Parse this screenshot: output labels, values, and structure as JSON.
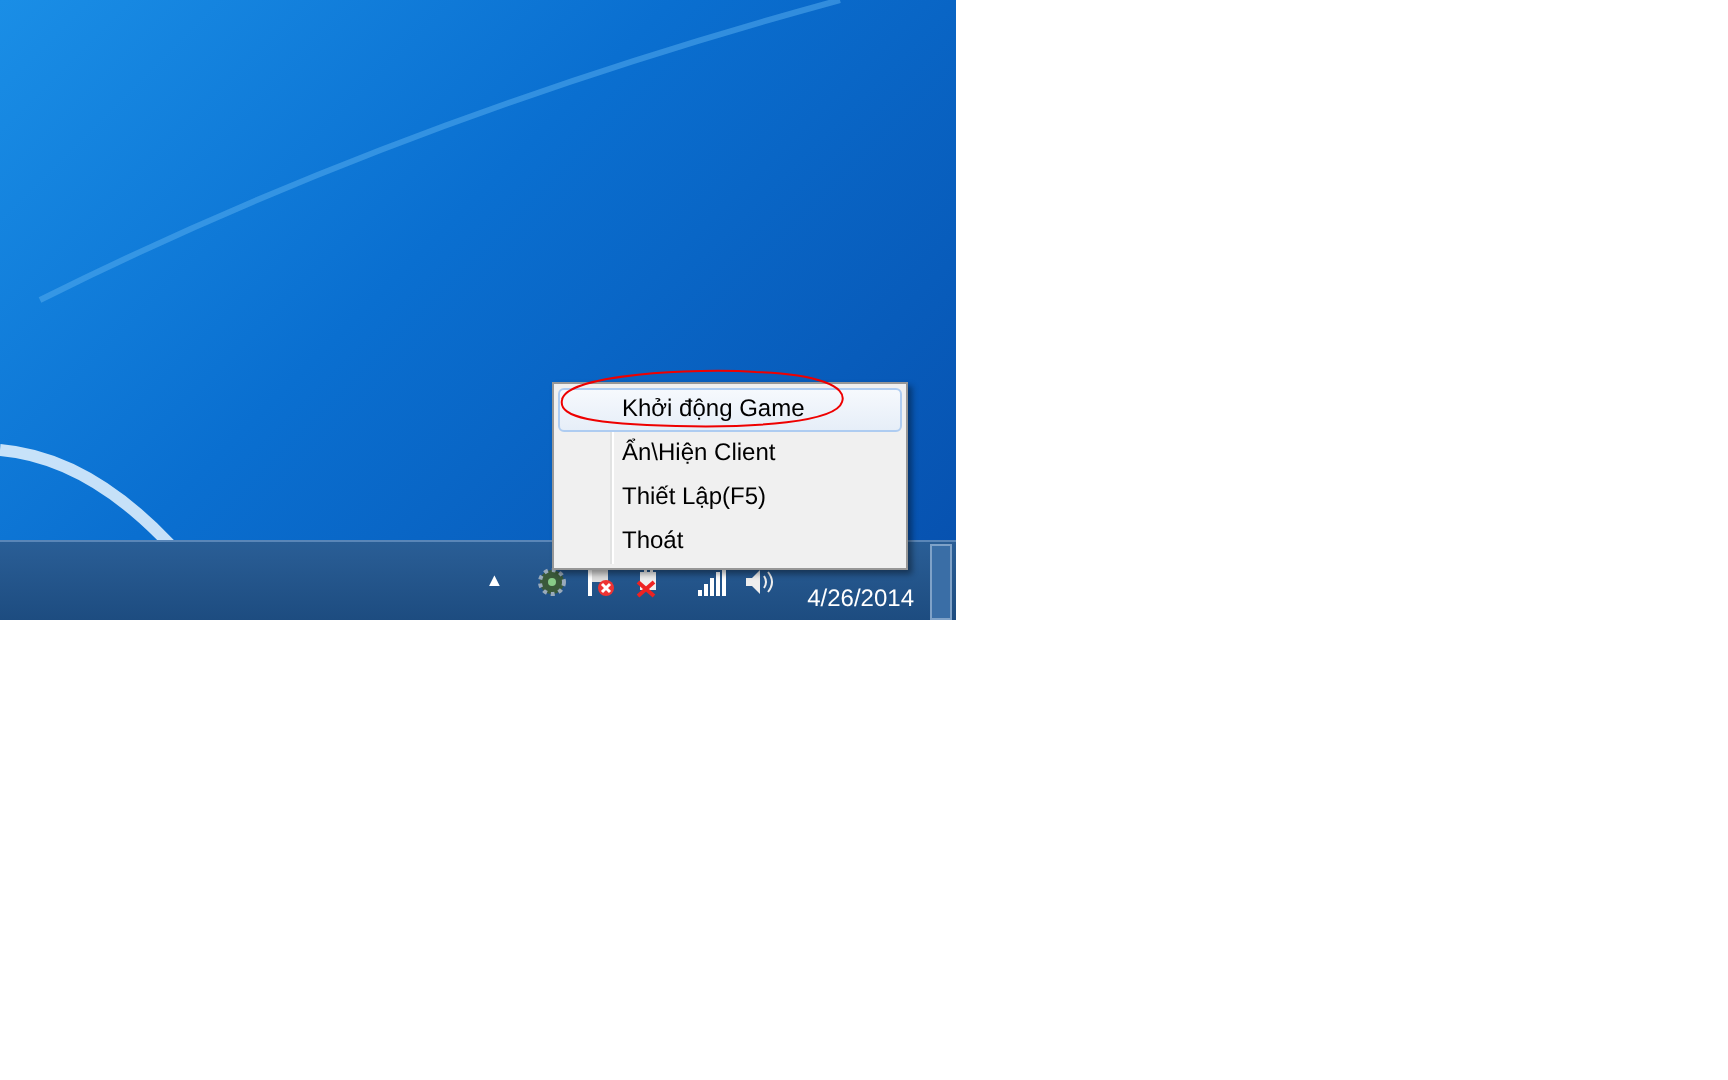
{
  "context_menu": {
    "items": [
      {
        "label": "Khởi động Game",
        "selected": true
      },
      {
        "label": "Ẩn\\Hiện Client",
        "selected": false
      },
      {
        "label": "Thiết Lập(F5)",
        "selected": false
      },
      {
        "label": "Thoát",
        "selected": false
      }
    ]
  },
  "taskbar": {
    "tray_overflow": "▲",
    "date": "4/26/2014"
  }
}
